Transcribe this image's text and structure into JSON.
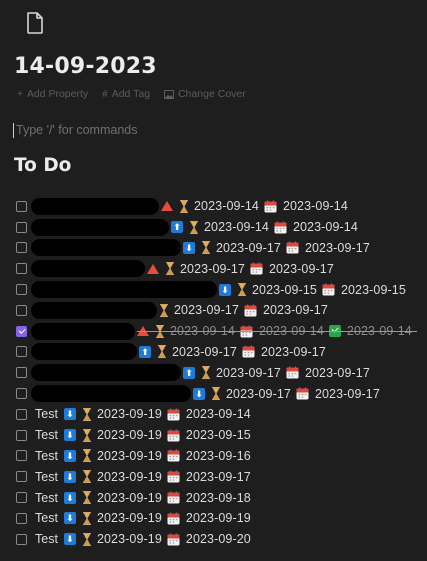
{
  "page": {
    "title": "14-09-2023",
    "icon": "page-icon",
    "properties": [
      {
        "icon": "plus-icon",
        "label": "Add Property"
      },
      {
        "icon": "hash-icon",
        "label": "Add Tag"
      },
      {
        "icon": "image-icon",
        "label": "Change Cover"
      }
    ],
    "command_placeholder": "Type '/' for commands",
    "section_heading": "To Do"
  },
  "colors": {
    "background": "#1e1e1e",
    "text": "#dcdcdc",
    "checkbox_checked": "#8663e8",
    "priority_high": "#e74c3c",
    "priority_arrow": "#1f7bd8",
    "done_check": "#2aa54b"
  },
  "todos": [
    {
      "text": "",
      "redacted": true,
      "checked": false,
      "priority": "high",
      "scheduled": "2023-09-14",
      "due": "2023-09-14",
      "done": ""
    },
    {
      "text": "",
      "redacted": true,
      "checked": false,
      "priority": "up",
      "scheduled": "2023-09-14",
      "due": "2023-09-14",
      "done": ""
    },
    {
      "text": "",
      "redacted": true,
      "checked": false,
      "priority": "down",
      "scheduled": "2023-09-17",
      "due": "2023-09-17",
      "done": ""
    },
    {
      "text": "",
      "redacted": true,
      "checked": false,
      "priority": "high",
      "scheduled": "2023-09-17",
      "due": "2023-09-17",
      "done": ""
    },
    {
      "text": "",
      "redacted": true,
      "checked": false,
      "priority": "down",
      "scheduled": "2023-09-15",
      "due": "2023-09-15",
      "done": ""
    },
    {
      "text": "",
      "redacted": true,
      "checked": false,
      "priority": "",
      "scheduled": "2023-09-17",
      "due": "2023-09-17",
      "done": ""
    },
    {
      "text": "",
      "redacted": true,
      "checked": true,
      "priority": "high",
      "scheduled": "2023-09-14",
      "due": "2023-09-14",
      "done": "2023-09-14"
    },
    {
      "text": "",
      "redacted": true,
      "checked": false,
      "priority": "up",
      "scheduled": "2023-09-17",
      "due": "2023-09-17",
      "done": ""
    },
    {
      "text": "",
      "redacted": true,
      "checked": false,
      "priority": "up",
      "scheduled": "2023-09-17",
      "due": "2023-09-17",
      "done": ""
    },
    {
      "text": "",
      "redacted": true,
      "checked": false,
      "priority": "down",
      "scheduled": "2023-09-17",
      "due": "2023-09-17",
      "done": ""
    },
    {
      "text": "Test",
      "redacted": false,
      "checked": false,
      "priority": "down",
      "scheduled": "2023-09-19",
      "due": "2023-09-14",
      "done": ""
    },
    {
      "text": "Test",
      "redacted": false,
      "checked": false,
      "priority": "down",
      "scheduled": "2023-09-19",
      "due": "2023-09-15",
      "done": ""
    },
    {
      "text": "Test",
      "redacted": false,
      "checked": false,
      "priority": "down",
      "scheduled": "2023-09-19",
      "due": "2023-09-16",
      "done": ""
    },
    {
      "text": "Test",
      "redacted": false,
      "checked": false,
      "priority": "down",
      "scheduled": "2023-09-19",
      "due": "2023-09-17",
      "done": ""
    },
    {
      "text": "Test",
      "redacted": false,
      "checked": false,
      "priority": "down",
      "scheduled": "2023-09-19",
      "due": "2023-09-18",
      "done": ""
    },
    {
      "text": "Test",
      "redacted": false,
      "checked": false,
      "priority": "down",
      "scheduled": "2023-09-19",
      "due": "2023-09-19",
      "done": ""
    },
    {
      "text": "Test",
      "redacted": false,
      "checked": false,
      "priority": "down",
      "scheduled": "2023-09-19",
      "due": "2023-09-20",
      "done": ""
    }
  ]
}
